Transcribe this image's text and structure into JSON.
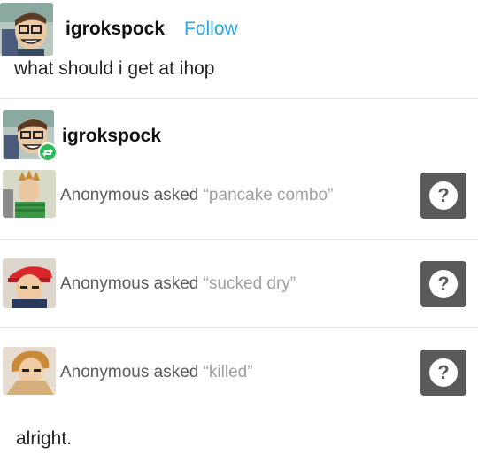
{
  "post": {
    "author": "igrokspock",
    "follow_label": "Follow",
    "body": "what should i get at ihop"
  },
  "reblog": {
    "author": "igrokspock",
    "asks": [
      {
        "asker": "Anonymous",
        "verb": "asked",
        "question": "“pancake combo”",
        "icon": "question-mark-icon"
      },
      {
        "asker": "Anonymous",
        "verb": "asked",
        "question": "“sucked dry”",
        "icon": "question-mark-icon"
      },
      {
        "asker": "Anonymous",
        "verb": "asked",
        "question": "“killed”",
        "icon": "question-mark-icon"
      }
    ],
    "reply": "alright."
  },
  "colors": {
    "follow": "#2aa6e6",
    "ask_button": "#5a5a5a",
    "reblog_badge": "#2ebc5a"
  },
  "ask_button_glyph": "?"
}
